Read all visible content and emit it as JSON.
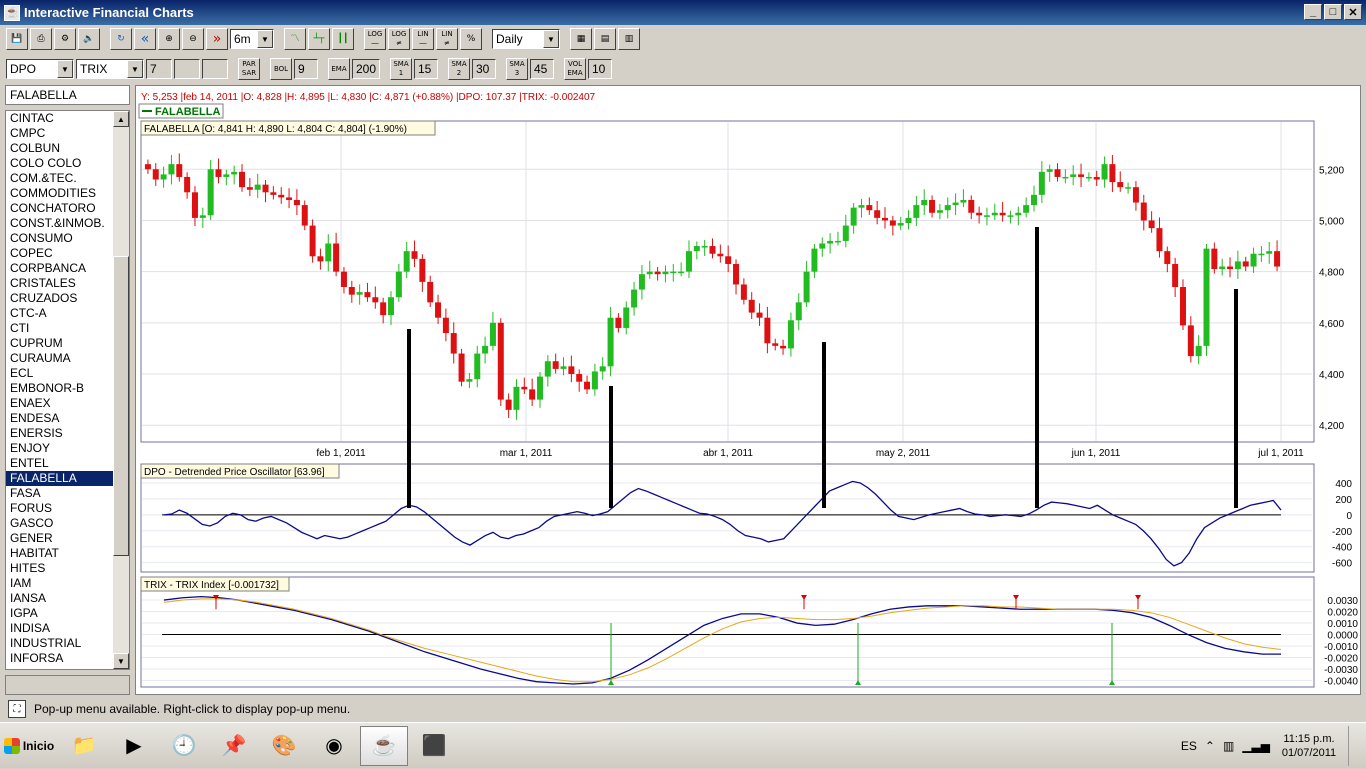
{
  "window": {
    "title": "Interactive Financial Charts",
    "app_icon": "java-icon"
  },
  "toolbar1": {
    "period": "6m",
    "interval": "Daily",
    "buttons": [
      {
        "name": "save-icon",
        "label": ""
      },
      {
        "name": "print-icon",
        "label": ""
      },
      {
        "name": "settings-icon",
        "label": ""
      },
      {
        "name": "sound-icon",
        "label": ""
      },
      {
        "name": "refresh-icon",
        "label": ""
      },
      {
        "name": "back-icon",
        "label": "«"
      },
      {
        "name": "zoom-in-icon",
        "label": ""
      },
      {
        "name": "zoom-out-icon",
        "label": ""
      },
      {
        "name": "forward-icon",
        "label": "»"
      }
    ],
    "chart_type_buttons": [
      "line-chart-icon",
      "bar-chart-icon",
      "candle-chart-icon"
    ],
    "scale_buttons": [
      {
        "line1": "LOG",
        "line2": ""
      },
      {
        "line1": "LOG",
        "line2": "≠"
      },
      {
        "line1": "LIN",
        "line2": ""
      },
      {
        "line1": "LIN",
        "line2": "≠"
      },
      {
        "line1": "%",
        "line2": ""
      }
    ]
  },
  "toolbar2": {
    "indicator1": "DPO",
    "indicator2": "TRIX",
    "indicator2_param": "7",
    "par_sar": "PAR\nSAR",
    "bol_label": "BOL",
    "bol_value": "9",
    "ema_label": "EMA",
    "ema_value": "200",
    "sma1_label": "SMA 1",
    "sma1_value": "15",
    "sma2_label": "SMA 2",
    "sma2_value": "30",
    "sma3_label": "SMA 3",
    "sma3_value": "45",
    "volema_label": "VOL EMA",
    "volema_value": "10"
  },
  "symbols": {
    "current": "FALABELLA",
    "list": [
      "CINTAC",
      "CMPC",
      "COLBUN",
      "COLO COLO",
      "COM.&TEC.",
      "COMMODITIES",
      "CONCHATORO",
      "CONST.&INMOB.",
      "CONSUMO",
      "COPEC",
      "CORPBANCA",
      "CRISTALES",
      "CRUZADOS",
      "CTC-A",
      "CTI",
      "CUPRUM",
      "CURAUMA",
      "ECL",
      "EMBONOR-B",
      "ENAEX",
      "ENDESA",
      "ENERSIS",
      "ENJOY",
      "ENTEL",
      "FALABELLA",
      "FASA",
      "FORUS",
      "GASCO",
      "GENER",
      "HABITAT",
      "HITES",
      "IAM",
      "IANSA",
      "IGPA",
      "INDISA",
      "INDUSTRIAL",
      "INFORSA"
    ],
    "selected": "FALABELLA"
  },
  "chart": {
    "info_line": "Y: 5,253 |feb 14, 2011 |O: 4,828 |H: 4,895 |L: 4,830 |C: 4,871 (+0.88%) |DPO: 107.37 |TRIX: -0.002407",
    "legend_symbol": "FALABELLA",
    "price_label": "FALABELLA [O: 4,841  H: 4,890  L: 4,804  C: 4,804] (-1.90%)",
    "dpo_label": "DPO - Detrended Price Oscillator [63.96]",
    "trix_label": "TRIX - TRIX Index [-0.001732]",
    "colors": {
      "up": "#22bb22",
      "down": "#dd1111",
      "dpo": "#0a0a8a",
      "trix": "#0a0a8a",
      "signal": "#e6a817",
      "info": "#cc0000",
      "legend": "#007700"
    }
  },
  "chart_data": [
    {
      "type": "candlestick",
      "title": "FALABELLA",
      "x_labels": [
        "feb 1, 2011",
        "mar 1, 2011",
        "abr 1, 2011",
        "may 2, 2011",
        "jun 1, 2011",
        "jul 1, 2011"
      ],
      "y_ticks": [
        "5,200",
        "5,000",
        "4,800",
        "4,600",
        "4,400",
        "4,200"
      ],
      "ylim": [
        4150,
        5330
      ],
      "closes": [
        5200,
        5160,
        5180,
        5220,
        5170,
        5110,
        5010,
        5020,
        5200,
        5170,
        5180,
        5190,
        5130,
        5120,
        5140,
        5110,
        5100,
        5090,
        5080,
        5060,
        4980,
        4860,
        4840,
        4910,
        4800,
        4740,
        4710,
        4720,
        4700,
        4680,
        4630,
        4700,
        4800,
        4880,
        4850,
        4760,
        4680,
        4620,
        4560,
        4480,
        4370,
        4380,
        4480,
        4510,
        4600,
        4300,
        4260,
        4350,
        4340,
        4300,
        4390,
        4450,
        4420,
        4430,
        4400,
        4370,
        4340,
        4410,
        4430,
        4620,
        4580,
        4660,
        4730,
        4790,
        4800,
        4790,
        4800,
        4800,
        4800,
        4880,
        4900,
        4900,
        4870,
        4860,
        4830,
        4750,
        4690,
        4640,
        4620,
        4520,
        4510,
        4500,
        4610,
        4680,
        4800,
        4890,
        4910,
        4920,
        4920,
        4980,
        5050,
        5060,
        5040,
        5010,
        5000,
        4980,
        4990,
        5010,
        5060,
        5080,
        5030,
        5040,
        5060,
        5070,
        5080,
        5030,
        5020,
        5020,
        5030,
        5020,
        5020,
        5030,
        5060,
        5100,
        5190,
        5200,
        5170,
        5170,
        5180,
        5170,
        5170,
        5160,
        5220,
        5150,
        5130,
        5130,
        5070,
        5000,
        4970,
        4880,
        4830,
        4740,
        4590,
        4470,
        4510,
        4890,
        4810,
        4820,
        4810,
        4840,
        4820,
        4870,
        4870,
        4880,
        4820
      ],
      "candles_note": "green = up, red = down",
      "annotations": "5 vertical black bars connecting price lows to DPO"
    },
    {
      "type": "line",
      "title": "DPO - Detrended Price Oscillator [63.96]",
      "y_ticks": [
        "400",
        "200",
        "0",
        "-200",
        "-400",
        "-600"
      ],
      "ylim": [
        -680,
        450
      ],
      "values": [
        0,
        10,
        60,
        20,
        -50,
        -120,
        -140,
        -100,
        -20,
        20,
        0,
        -60,
        -80,
        -40,
        -20,
        -60,
        -100,
        -160,
        -220,
        -260,
        -300,
        -260,
        -280,
        -300,
        -280,
        -240,
        -200,
        -160,
        -120,
        -80,
        0,
        80,
        120,
        100,
        40,
        -40,
        -120,
        -200,
        -280,
        -340,
        -380,
        -320,
        -260,
        -220,
        -280,
        -300,
        -260,
        -240,
        -200,
        -160,
        -80,
        -20,
        0,
        20,
        40,
        20,
        -10,
        10,
        40,
        120,
        200,
        280,
        330,
        300,
        260,
        220,
        180,
        140,
        100,
        60,
        20,
        10,
        -20,
        -60,
        -120,
        -200,
        -260,
        -280,
        -300,
        -340,
        -320,
        -300,
        -200,
        -100,
        0,
        100,
        200,
        300,
        340,
        380,
        420,
        400,
        340,
        260,
        160,
        60,
        -20,
        -40,
        -60,
        -30,
        0,
        20,
        40,
        60,
        80,
        40,
        10,
        0,
        -20,
        -10,
        0,
        -10,
        -20,
        10,
        60,
        120,
        160,
        150,
        140,
        120,
        100,
        80,
        120,
        60,
        0,
        -40,
        -80,
        -120,
        -200,
        -300,
        -420,
        -560,
        -640,
        -600,
        -480,
        -300,
        -160,
        -100,
        -40,
        0,
        40,
        80,
        120,
        140,
        160,
        180,
        60
      ],
      "zero_line": true
    },
    {
      "type": "line",
      "title": "TRIX - TRIX Index [-0.001732]",
      "y_ticks": [
        "0.0030",
        "0.0020",
        "0.0010",
        "0.0000",
        "-0.0010",
        "-0.0020",
        "-0.0030",
        "-0.0040"
      ],
      "ylim": [
        -0.0043,
        0.0037
      ],
      "series": [
        {
          "values": [
            0.003,
            0.0032,
            0.0033,
            0.0032,
            0.003,
            0.0027,
            0.0024,
            0.0021,
            0.0017,
            0.0013,
            0.0008,
            0.0003,
            -0.0003,
            -0.0009,
            -0.0015,
            -0.002,
            -0.0025,
            -0.003,
            -0.0034,
            -0.0038,
            -0.0041,
            -0.0042,
            -0.0043,
            -0.0042,
            -0.0038,
            -0.0031,
            -0.0022,
            -0.0012,
            -0.0002,
            0.0008,
            0.0014,
            0.0018,
            0.0018,
            0.0015,
            0.001,
            0.0008,
            0.0009,
            0.0013,
            0.0018,
            0.0022,
            0.0024,
            0.0025,
            0.0025,
            0.0025,
            0.0024,
            0.0023,
            0.0022,
            0.0022,
            0.0022,
            0.0022,
            0.0022,
            0.0021,
            0.0019,
            0.0015,
            0.0008,
            0.0,
            -0.0007,
            -0.0012,
            -0.0015,
            -0.0017,
            -0.0017
          ]
        },
        {
          "values": [
            0.0028,
            0.003,
            0.0031,
            0.0031,
            0.003,
            0.0028,
            0.0025,
            0.0022,
            0.0018,
            0.0014,
            0.0009,
            0.0004,
            -0.0002,
            -0.0007,
            -0.0012,
            -0.0016,
            -0.002,
            -0.0024,
            -0.0028,
            -0.0032,
            -0.0036,
            -0.0039,
            -0.0041,
            -0.0041,
            -0.0039,
            -0.0035,
            -0.0029,
            -0.0021,
            -0.0012,
            -0.0003,
            0.0005,
            0.0011,
            0.0014,
            0.0015,
            0.0014,
            0.0013,
            0.0013,
            0.0014,
            0.0016,
            0.0019,
            0.0021,
            0.0023,
            0.0024,
            0.0025,
            0.0025,
            0.0024,
            0.0024,
            0.0023,
            0.0022,
            0.0022,
            0.0022,
            0.0022,
            0.0021,
            0.0019,
            0.0015,
            0.0009,
            0.0003,
            -0.0003,
            -0.0008,
            -0.0011,
            -0.0013
          ]
        }
      ],
      "zero_line": true
    }
  ],
  "status": {
    "text": "Pop-up menu available. Right-click to display pop-up menu."
  },
  "taskbar": {
    "start_label": "Inicio",
    "apps": [
      "explorer-icon",
      "media-player-icon",
      "clock-icon",
      "pushpin-icon",
      "paint-icon",
      "chrome-icon",
      "java-icon",
      "pdf-icon"
    ],
    "lang": "ES",
    "time": "11:15 p.m.",
    "date": "01/07/2011"
  }
}
